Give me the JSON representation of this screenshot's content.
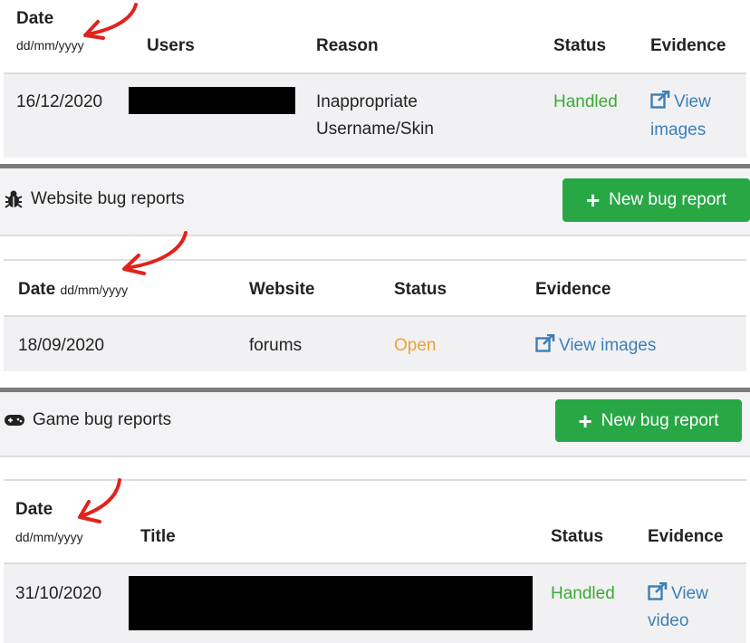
{
  "section1": {
    "headers": {
      "date": "Date",
      "date_format": "dd/mm/yyyy",
      "users": "Users",
      "reason": "Reason",
      "status": "Status",
      "evidence": "Evidence"
    },
    "row": {
      "date": "16/12/2020",
      "reason_line1": "Inappropriate",
      "reason_line2": "Username/Skin",
      "status": "Handled",
      "evidence_line1": "View",
      "evidence_line2": "images"
    }
  },
  "website_bugs": {
    "title": "Website bug reports",
    "icon": "bug-icon",
    "new_button": "New bug report",
    "headers": {
      "date": "Date",
      "date_format": "dd/mm/yyyy",
      "website": "Website",
      "status": "Status",
      "evidence": "Evidence"
    },
    "row": {
      "date": "18/09/2020",
      "website": "forums",
      "status": "Open",
      "evidence": "View images"
    }
  },
  "game_bugs": {
    "title": "Game bug reports",
    "icon": "gamepad-icon",
    "new_button": "New bug report",
    "headers": {
      "date": "Date",
      "date_format": "dd/mm/yyyy",
      "title": "Title",
      "status": "Status",
      "evidence": "Evidence"
    },
    "row": {
      "date": "31/10/2020",
      "status": "Handled",
      "evidence_line1": "View",
      "evidence_line2": "video"
    }
  },
  "colors": {
    "handled": "#3aaa35",
    "open": "#f0a030",
    "link": "#3b7fb6",
    "button": "#28a745",
    "annotation_arrow": "#e0231c"
  }
}
